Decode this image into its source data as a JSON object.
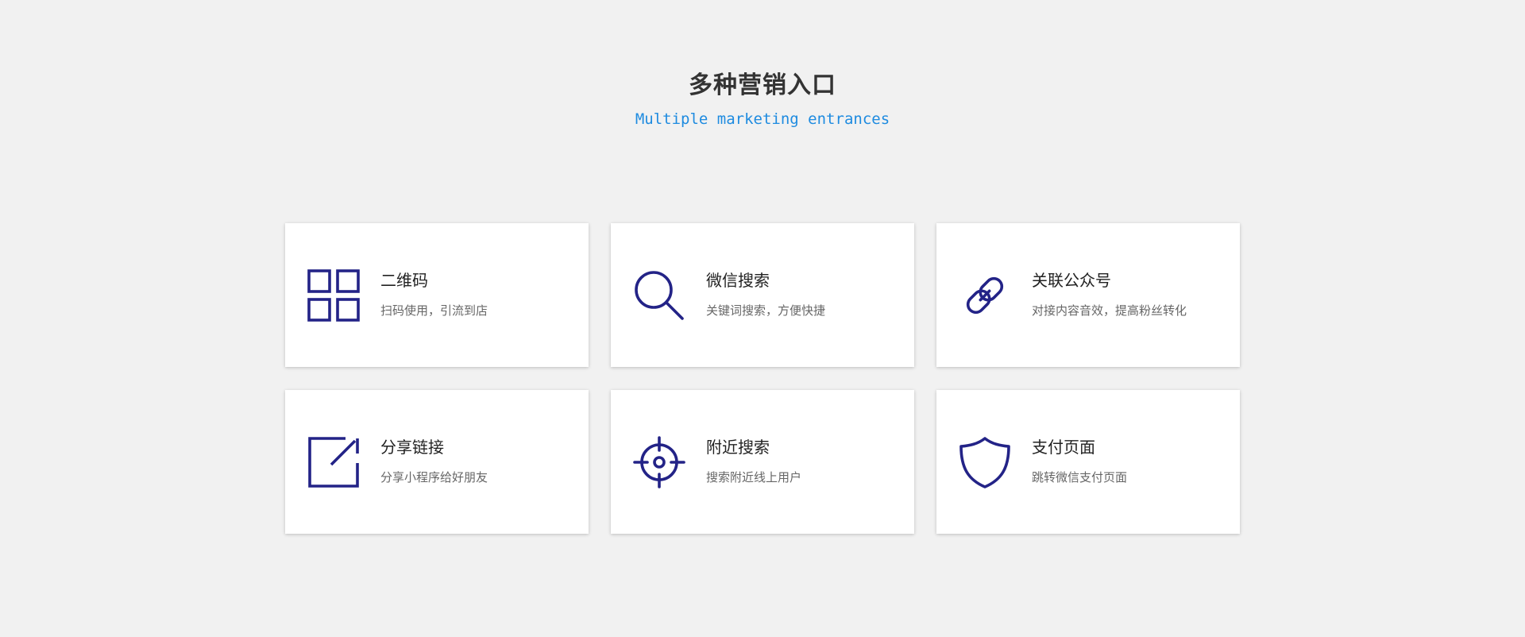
{
  "section": {
    "title": "多种营销入口",
    "subtitle": "Multiple marketing entrances"
  },
  "accent_color": "#232387",
  "subtitle_color": "#1e8be0",
  "cards": [
    {
      "icon": "qrcode-grid-icon",
      "name": "二维码",
      "desc": "扫码使用，引流到店"
    },
    {
      "icon": "search-icon",
      "name": "微信搜索",
      "desc": "关键词搜索，方便快捷"
    },
    {
      "icon": "link-icon",
      "name": "关联公众号",
      "desc": "对接内容音效，提高粉丝转化"
    },
    {
      "icon": "share-external-icon",
      "name": "分享链接",
      "desc": "分享小程序给好朋友"
    },
    {
      "icon": "crosshair-icon",
      "name": "附近搜索",
      "desc": "搜索附近线上用户"
    },
    {
      "icon": "shield-icon",
      "name": "支付页面",
      "desc": "跳转微信支付页面"
    }
  ]
}
